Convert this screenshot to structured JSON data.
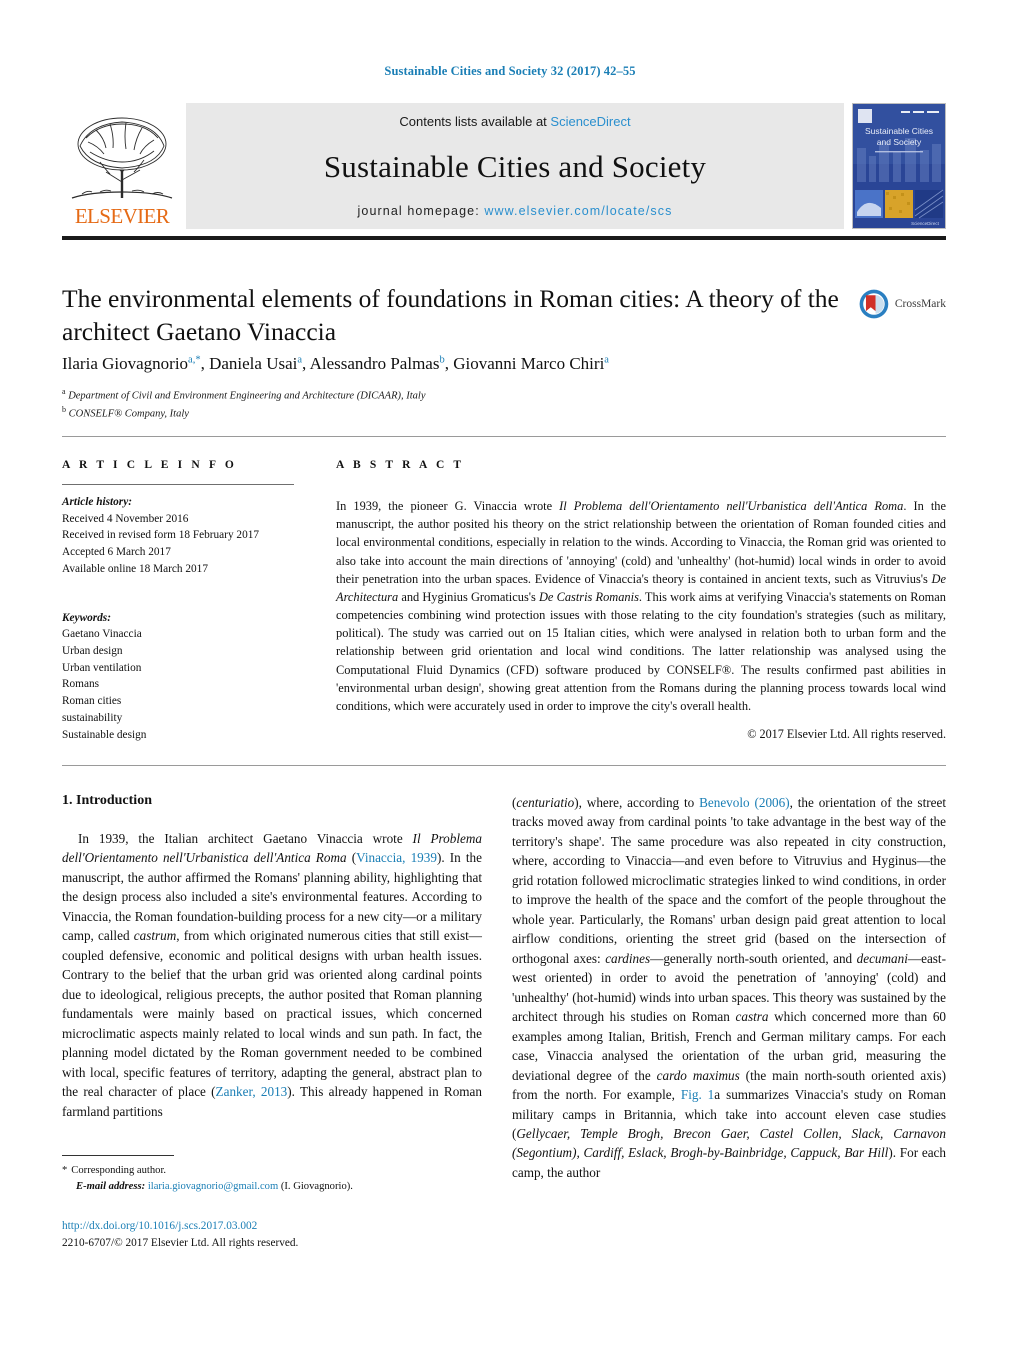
{
  "running_head": "Sustainable Cities and Society 32 (2017) 42–55",
  "masthead": {
    "elsevier_wordmark": "ELSEVIER",
    "contents_prefix": "Contents lists available at ",
    "contents_link": "ScienceDirect",
    "journal_name": "Sustainable Cities and Society",
    "homepage_prefix": "journal homepage: ",
    "homepage_url": "www.elsevier.com/locate/scs",
    "cover_title_line1": "Sustainable Cities",
    "cover_title_line2": "and Society"
  },
  "article": {
    "title": "The environmental elements of foundations in Roman cities: A theory of the architect Gaetano Vinaccia",
    "crossmark_label": "CrossMark",
    "authors": [
      {
        "name": "Ilaria Giovagnorio",
        "marks": "a,*"
      },
      {
        "name": "Daniela Usai",
        "marks": "a"
      },
      {
        "name": "Alessandro Palmas",
        "marks": "b"
      },
      {
        "name": "Giovanni Marco Chiri",
        "marks": "a"
      }
    ],
    "affiliations": [
      {
        "mark": "a",
        "text": "Department of Civil and Environment Engineering and Architecture (DICAAR), Italy"
      },
      {
        "mark": "b",
        "text": "CONSELF® Company, Italy"
      }
    ]
  },
  "info": {
    "heading": "A R T I C L E  I N F O",
    "history_label": "Article history:",
    "history": [
      "Received 4 November 2016",
      "Received in revised form 18 February 2017",
      "Accepted 6 March 2017",
      "Available online 18 March 2017"
    ],
    "keywords_label": "Keywords:",
    "keywords": [
      "Gaetano Vinaccia",
      "Urban design",
      "Urban ventilation",
      "Romans",
      "Roman cities",
      "sustainability",
      "Sustainable design"
    ]
  },
  "abstract": {
    "heading": "A B S T R A C T",
    "copyright": "© 2017 Elsevier Ltd. All rights reserved.",
    "parts": [
      {
        "t": "In 1939, the pioneer G. Vinaccia wrote ",
        "i": false
      },
      {
        "t": "Il Problema dell'Orientamento nell'Urbanistica dell'Antica Roma",
        "i": true
      },
      {
        "t": ". In the manuscript, the author posited his theory on the strict relationship between the orientation of Roman founded cities and local environmental conditions, especially in relation to the winds. According to Vinaccia, the Roman grid was oriented to also take into account the main directions of 'annoying' (cold) and 'unhealthy' (hot-humid) local winds in order to avoid their penetration into the urban spaces. Evidence of Vinaccia's theory is contained in ancient texts, such as Vitruvius's ",
        "i": false
      },
      {
        "t": "De Architectura",
        "i": true
      },
      {
        "t": " and Hyginius Gromaticus's ",
        "i": false
      },
      {
        "t": "De Castris Romanis",
        "i": true
      },
      {
        "t": ". This work aims at verifying Vinaccia's statements on Roman competencies combining wind protection issues with those relating to the city foundation's strategies (such as military, political). The study was carried out on 15 Italian cities, which were analysed in relation both to urban form and the relationship between grid orientation and local wind conditions. The latter relationship was analysed using the Computational Fluid Dynamics (CFD) software produced by CONSELF®. The results confirmed past abilities in 'environmental urban design', showing great attention from the Romans during the planning process towards local wind conditions, which were accurately used in order to improve the city's overall health.",
        "i": false
      }
    ]
  },
  "body": {
    "section_number_title": "1. Introduction",
    "left_parts": [
      {
        "t": "In 1939, the Italian architect Gaetano Vinaccia wrote ",
        "i": false,
        "link": false
      },
      {
        "t": "Il Problema dell'Orientamento nell'Urbanistica dell'Antica Roma",
        "i": true,
        "link": false
      },
      {
        "t": " (",
        "i": false,
        "link": false
      },
      {
        "t": "Vinaccia, 1939",
        "i": false,
        "link": true
      },
      {
        "t": "). In the manuscript, the author affirmed the Romans' planning ability, highlighting that the design process also included a site's environmental features. According to Vinaccia, the Roman foundation-building process for a new city—or a military camp, called ",
        "i": false,
        "link": false
      },
      {
        "t": "castrum",
        "i": true,
        "link": false
      },
      {
        "t": ", from which originated numerous cities that still exist—coupled defensive, economic and political designs with urban health issues. Contrary to the belief that the urban grid was oriented along cardinal points due to ideological, religious precepts, the author posited that Roman planning fundamentals were mainly based on practical issues, which concerned microclimatic aspects mainly related to local winds and sun path. In fact, the planning model dictated by the Roman government needed to be combined with local, specific features of territory, adapting the general, abstract plan to the real character of place (",
        "i": false,
        "link": false
      },
      {
        "t": "Zanker, 2013",
        "i": false,
        "link": true
      },
      {
        "t": "). This already happened in Roman farmland partitions",
        "i": false,
        "link": false
      }
    ],
    "right_parts": [
      {
        "t": "(",
        "i": false,
        "link": false
      },
      {
        "t": "centuriatio",
        "i": true,
        "link": false
      },
      {
        "t": "), where, according to ",
        "i": false,
        "link": false
      },
      {
        "t": "Benevolo (2006)",
        "i": false,
        "link": true
      },
      {
        "t": ", the orientation of the street tracks moved away from cardinal points 'to take advantage in the best way of the territory's shape'. The same procedure was also repeated in city construction, where, according to Vinaccia—and even before to Vitruvius and Hyginus—the grid rotation followed microclimatic strategies linked to wind conditions, in order to improve the health of the space and the comfort of the people throughout the whole year. Particularly, the Romans' urban design paid great attention to local airflow conditions, orienting the street grid (based on the intersection of orthogonal axes: ",
        "i": false,
        "link": false
      },
      {
        "t": "cardines",
        "i": true,
        "link": false
      },
      {
        "t": "—generally north-south oriented, and ",
        "i": false,
        "link": false
      },
      {
        "t": "decumani",
        "i": true,
        "link": false
      },
      {
        "t": "—east-west oriented) in order to avoid the penetration of 'annoying' (cold) and 'unhealthy' (hot-humid) winds into urban spaces. This theory was sustained by the architect through his studies on Roman ",
        "i": false,
        "link": false
      },
      {
        "t": "castra",
        "i": true,
        "link": false
      },
      {
        "t": " which concerned more than 60 examples among Italian, British, French and German military camps. For each case, Vinaccia analysed the orientation of the urban grid, measuring the deviational degree of the ",
        "i": false,
        "link": false
      },
      {
        "t": "cardo maximus",
        "i": true,
        "link": false
      },
      {
        "t": " (the main north-south oriented axis) from the north. For example, ",
        "i": false,
        "link": false
      },
      {
        "t": "Fig. 1",
        "i": false,
        "link": true
      },
      {
        "t": "a summarizes Vinaccia's study on Roman military camps in Britannia, which take into account eleven case studies (",
        "i": false,
        "link": false
      },
      {
        "t": "Gellycaer, Temple Brogh, Brecon Gaer, Castel Collen, Slack, Carnavon (Segontium), Cardiff, Eslack, Brogh-by-Bainbridge, Cappuck, Bar Hill",
        "i": true,
        "link": false
      },
      {
        "t": "). For each camp, the author",
        "i": false,
        "link": false
      }
    ]
  },
  "footnote": {
    "corresponding_star": "*",
    "corresponding_text": "Corresponding author.",
    "email_label": "E-mail address:",
    "email": "ilaria.giovagnorio@gmail.com",
    "email_attrib": "(I. Giovagnorio)."
  },
  "footer": {
    "doi": "http://dx.doi.org/10.1016/j.scs.2017.03.002",
    "issn_line": "2210-6707/© 2017 Elsevier Ltd. All rights reserved."
  },
  "colors": {
    "link_blue": "#1a7eb5",
    "elsevier_orange": "#e56a15",
    "banner_grey": "#e8e8e8"
  }
}
